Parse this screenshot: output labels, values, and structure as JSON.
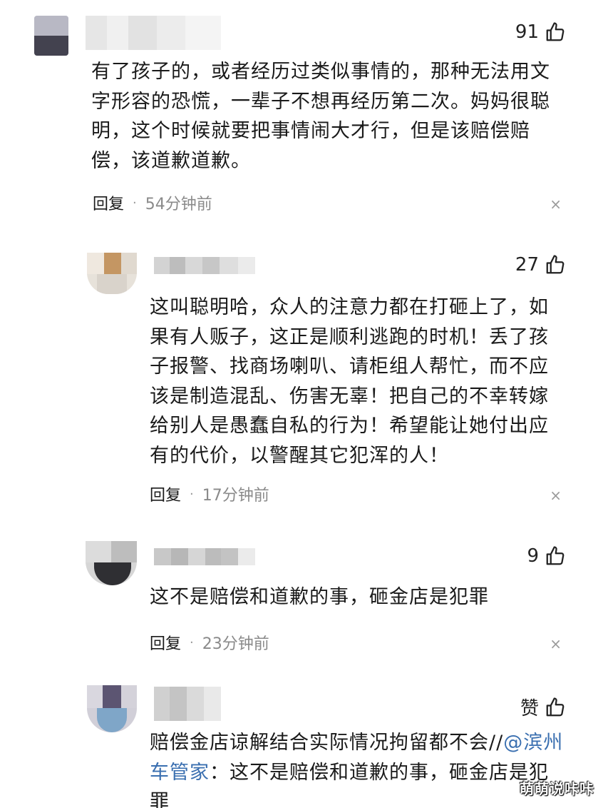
{
  "comments": [
    {
      "likes": "91",
      "text_lines": [
        "有了孩子的，或者经历过类似事情的，那种无法用文",
        "字形容的恐慌，一辈子不想再经历第二次。妈妈很聪",
        "明，这个时候就要把事情闹大才行，但是该赔偿赔",
        "偿，该道歉道歉。"
      ],
      "reply_label": "回复",
      "time": "54分钟前"
    },
    {
      "likes": "27",
      "text_lines": [
        "这叫聪明哈，众人的注意力都在打砸上了，如",
        "果有人贩子，这正是顺利逃跑的时机！丢了孩",
        "子报警、找商场喇叭、请柜组人帮忙，而不应",
        "该是制造混乱、伤害无辜！把自己的不幸转嫁",
        "给别人是愚蠢自私的行为！希望能让她付出应",
        "有的代价，以警醒其它犯浑的人！"
      ],
      "reply_label": "回复",
      "time": "17分钟前"
    },
    {
      "likes": "9",
      "text_lines": [
        "这不是赔偿和道歉的事，砸金店是犯罪"
      ],
      "reply_label": "回复",
      "time": "23分钟前"
    },
    {
      "likes": "赞",
      "text_line1_before": "赔偿金店谅解结合实际情况拘留都不会//",
      "mention": "@滨州",
      "text_line2_mention": "车管家",
      "text_line2_rest": "：这不是赔偿和道歉的事，砸金店是犯",
      "text_line3": "罪"
    }
  ],
  "close_symbol": "×",
  "dot_symbol": "·",
  "watermark": "萌萌说咔咔",
  "colors": {
    "text": "#1a1a1a",
    "meta_gray": "#8a8a8a",
    "mention_blue": "#3a6fb0"
  }
}
